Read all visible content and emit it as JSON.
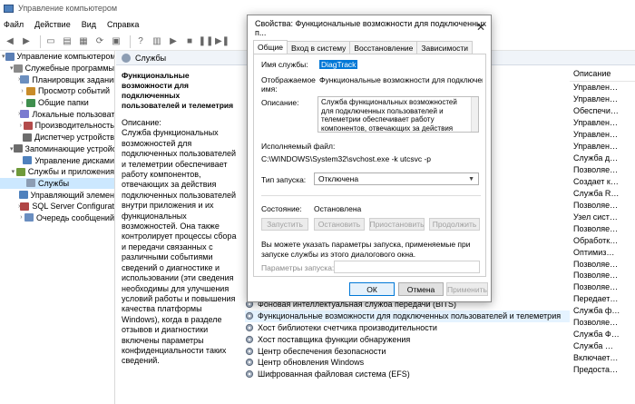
{
  "window": {
    "title": "Управление компьютером"
  },
  "menu": [
    "Файл",
    "Действие",
    "Вид",
    "Справка"
  ],
  "tree": [
    {
      "label": "Управление компьютером (л",
      "level": 0,
      "exp": "▾"
    },
    {
      "label": "Служебные программы",
      "level": 1,
      "exp": "▾"
    },
    {
      "label": "Планировщик заданий",
      "level": 2,
      "exp": "›"
    },
    {
      "label": "Просмотр событий",
      "level": 2,
      "exp": "›"
    },
    {
      "label": "Общие папки",
      "level": 2,
      "exp": "›"
    },
    {
      "label": "Локальные пользовате",
      "level": 2,
      "exp": "›"
    },
    {
      "label": "Производительность",
      "level": 2,
      "exp": "›"
    },
    {
      "label": "Диспетчер устройств",
      "level": 2,
      "exp": ""
    },
    {
      "label": "Запоминающие устройст",
      "level": 1,
      "exp": "▾"
    },
    {
      "label": "Управление дисками",
      "level": 2,
      "exp": ""
    },
    {
      "label": "Службы и приложения",
      "level": 1,
      "exp": "▾"
    },
    {
      "label": "Службы",
      "level": 2,
      "exp": "",
      "selected": true
    },
    {
      "label": "Управляющий элемен",
      "level": 2,
      "exp": ""
    },
    {
      "label": "SQL Server Configurati",
      "level": 2,
      "exp": "›"
    },
    {
      "label": "Очередь сообщений",
      "level": 2,
      "exp": "›"
    }
  ],
  "center": {
    "header": "Службы",
    "service_title": "Функциональные возможности для подключенных пользователей и телеметрия",
    "desc_label": "Описание:",
    "description": "Служба функциональных возможностей для подключенных пользователей и телеметрии обеспечивает работу компонентов, отвечающих за действия подключенных пользователей внутри приложения и их функциональных возможностей. Она также контролирует процессы сбора и передачи связанных с различными событиями сведений о диагностике и использовании (эти сведения необходимы для улучшения условий работы и повышения качества платформы Windows), когда в разделе отзывов и диагностики включены параметры конфиденциальности таких сведений."
  },
  "services_visible": [
    "Фоновая интеллектуальная служба передачи (BITS)",
    "Функциональные возможности для подключенных пользователей и телеметрия",
    "Хост библиотеки счетчика производительности",
    "Хост поставщика функции обнаружения",
    "Центр обеспечения безопасности",
    "Центр обновления Windows",
    "Шифрованная файловая система (EFS)"
  ],
  "right_column": {
    "header": "Описание",
    "rows": [
      "Управлен…",
      "Управлен…",
      "Обеспечи…",
      "Управлен…",
      "Управлен…",
      "Управлен…",
      "Служба д…",
      "Позволяе…",
      "Создает к…",
      "Служба R…",
      "Позволяе…",
      "Узел сист…",
      "Позволяе…",
      "Обработк…",
      "Оптимиз…",
      "Позволяе…",
      "Позволяе…",
      "Позволяе…",
      "Передает…",
      "Служба ф…",
      "Позволяе…",
      "Служба Ф…",
      "Служба …",
      "Включает…",
      "Предоста…"
    ]
  },
  "dialog": {
    "title": "Свойства: Функциональные возможности для подключенных п...",
    "close": "✕",
    "tabs": [
      "Общие",
      "Вход в систему",
      "Восстановление",
      "Зависимости"
    ],
    "service_name_label": "Имя службы:",
    "service_name": "DiagTrack",
    "display_name_label": "Отображаемое имя:",
    "display_name": "Функциональные возможности для подключенных г",
    "description_label": "Описание:",
    "description": "Служба функциональных возможностей для подключенных пользователей и телеметрии обеспечивает работу компонентов, отвечающих за действия подключенных пользователей",
    "exe_label": "Исполняемый файл:",
    "exe_path": "C:\\WINDOWS\\System32\\svchost.exe -k utcsvc -p",
    "startup_label": "Тип запуска:",
    "startup_value": "Отключена",
    "status_label": "Состояние:",
    "status_value": "Остановлена",
    "buttons": {
      "start": "Запустить",
      "stop": "Остановить",
      "pause": "Приостановить",
      "resume": "Продолжить"
    },
    "params_hint": "Вы можете указать параметры запуска, применяемые при запуске службы из этого диалогового окна.",
    "params_label": "Параметры запуска:",
    "ok": "ОК",
    "cancel": "Отмена",
    "apply": "Применить"
  }
}
